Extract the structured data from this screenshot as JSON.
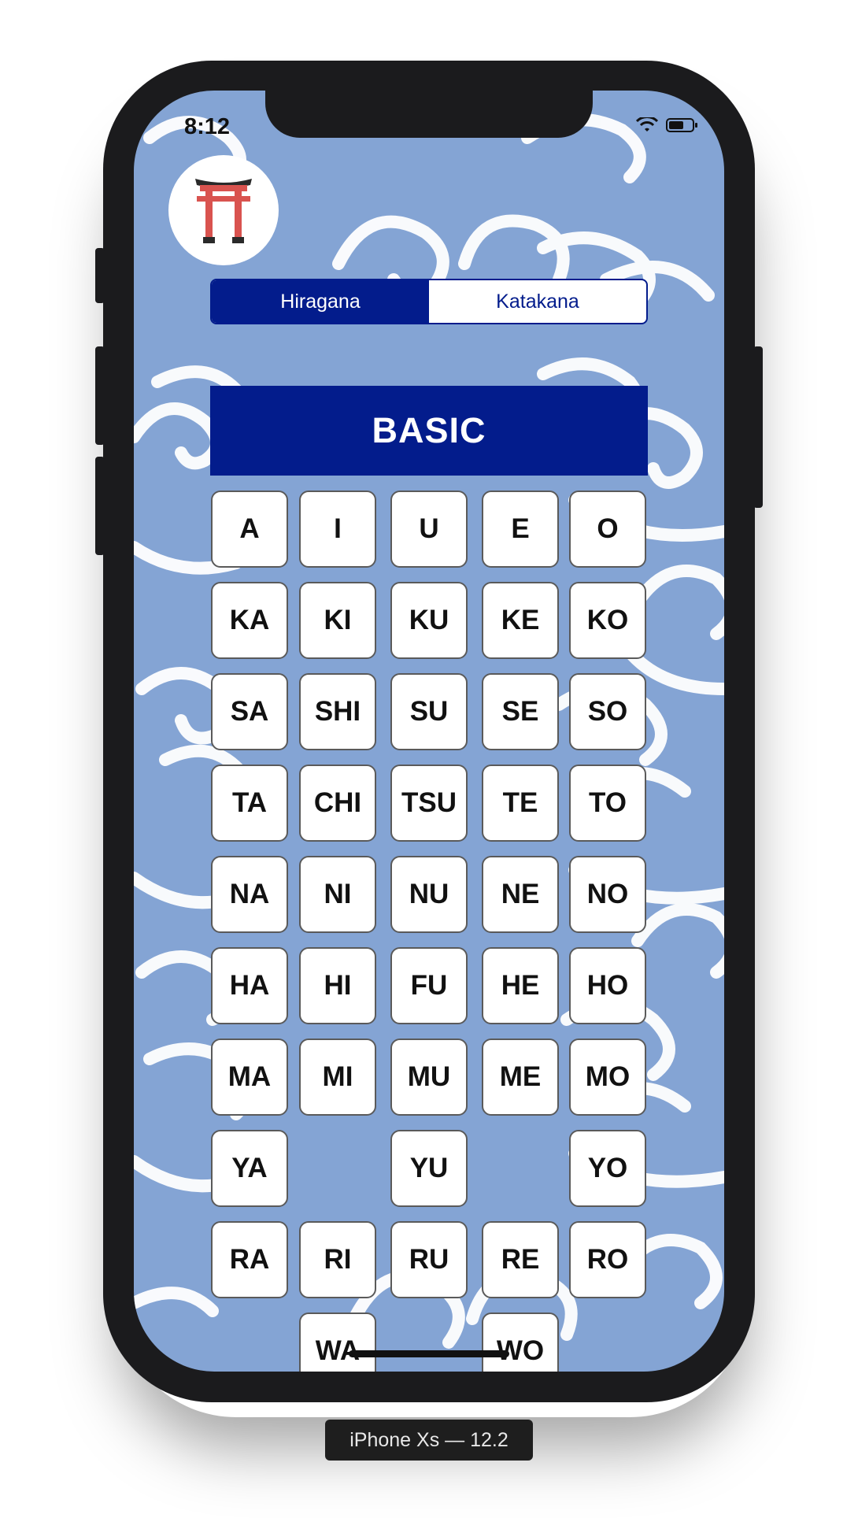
{
  "status_bar": {
    "time": "8:12"
  },
  "logo": {
    "icon": "torii-gate-icon"
  },
  "segmented_control": {
    "options": [
      "Hiragana",
      "Katakana"
    ],
    "selected": "Hiragana"
  },
  "section": {
    "title": "BASIC"
  },
  "kana_rows": [
    [
      "A",
      "I",
      "U",
      "E",
      "O"
    ],
    [
      "KA",
      "KI",
      "KU",
      "KE",
      "KO"
    ],
    [
      "SA",
      "SHI",
      "SU",
      "SE",
      "SO"
    ],
    [
      "TA",
      "CHI",
      "TSU",
      "TE",
      "TO"
    ],
    [
      "NA",
      "NI",
      "NU",
      "NE",
      "NO"
    ],
    [
      "HA",
      "HI",
      "FU",
      "HE",
      "HO"
    ],
    [
      "MA",
      "MI",
      "MU",
      "ME",
      "MO"
    ],
    [
      "YA",
      null,
      "YU",
      null,
      "YO"
    ],
    [
      "RA",
      "RI",
      "RU",
      "RE",
      "RO"
    ],
    [
      null,
      "WA",
      null,
      "WO",
      null
    ]
  ],
  "device_label": "iPhone Xs — 12.2",
  "colors": {
    "primary": "#031c8c",
    "background": "#84a4d4",
    "button": "#ffffff",
    "torii": "#d9534f"
  }
}
